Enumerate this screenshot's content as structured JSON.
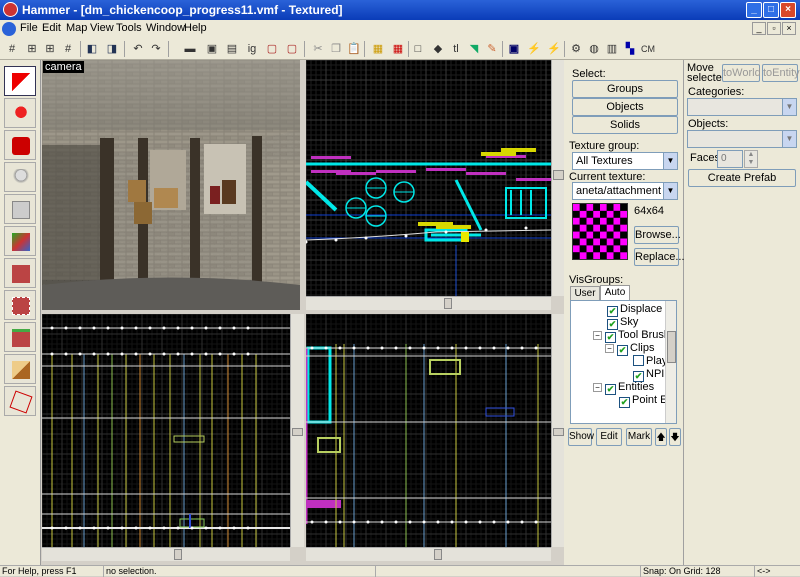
{
  "window": {
    "title": "Hammer - [dm_chickencoop_progress11.vmf - Textured]"
  },
  "menu": [
    "File",
    "Edit",
    "Map",
    "View",
    "Tools",
    "Window",
    "Help"
  ],
  "toolbar": {
    "cm_label": "CM"
  },
  "views": {
    "camera_label": "camera"
  },
  "select": {
    "label": "Select:",
    "groups": "Groups",
    "objects": "Objects",
    "solids": "Solids"
  },
  "texture": {
    "group_label": "Texture group:",
    "group_value": "All Textures",
    "current_label": "Current texture:",
    "current_value": "aneta/attachment",
    "size": "64x64",
    "browse": "Browse...",
    "replace": "Replace...",
    "colors": {
      "a": "#ff00ff",
      "b": "#000000"
    }
  },
  "move": {
    "label": "Move selected:",
    "to_world": "toWorld",
    "to_entity": "toEntity"
  },
  "categories_label": "Categories:",
  "objects_label": "Objects:",
  "faces": {
    "label": "Faces:",
    "value": "0"
  },
  "create_prefab": "Create Prefab",
  "visgroups": {
    "label": "VisGroups:",
    "tabs": [
      "User",
      "Auto"
    ],
    "items": [
      {
        "label": "Displace",
        "checked": true
      },
      {
        "label": "Sky",
        "checked": true
      },
      {
        "label": "Tool Brushes",
        "checked": true
      },
      {
        "label": "Clips",
        "checked": true
      },
      {
        "label": "Play",
        "checked": false
      },
      {
        "label": "NPI",
        "checked": true
      },
      {
        "label": "Entities",
        "checked": true
      },
      {
        "label": "Point En",
        "checked": true
      }
    ],
    "buttons": {
      "show": "Show",
      "edit": "Edit",
      "mark": "Mark",
      "up": "🡅",
      "down": "🡇"
    }
  },
  "status": {
    "help": "For Help, press F1",
    "selection": "no selection.",
    "snap": "Snap: On Grid: 128",
    "arrows": "<->"
  }
}
